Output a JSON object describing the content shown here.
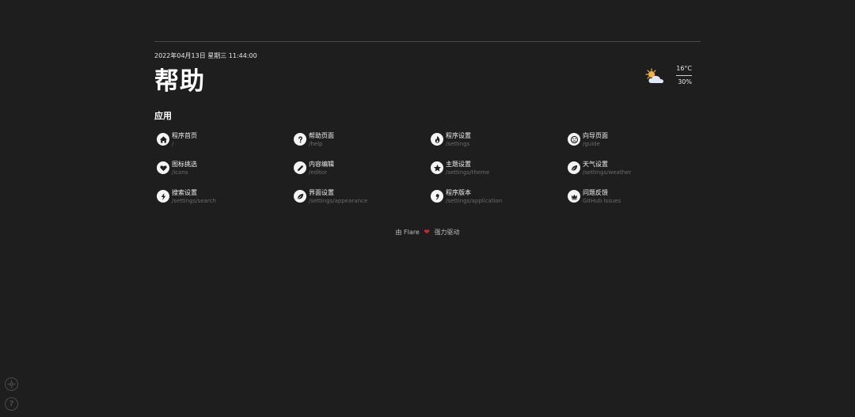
{
  "header": {
    "datetime": "2022年04月13日 星期三 11:44:00",
    "title": "帮助"
  },
  "weather": {
    "icon": "partly-cloudy-icon",
    "temperature": "16°C",
    "humidity": "30%"
  },
  "section": {
    "title": "应用"
  },
  "apps": [
    {
      "name": "程序首页",
      "path": "/",
      "icon": "home-icon"
    },
    {
      "name": "帮助页面",
      "path": "/help",
      "icon": "question-icon"
    },
    {
      "name": "程序设置",
      "path": "/settings",
      "icon": "fire-icon"
    },
    {
      "name": "向导页面",
      "path": "/guide",
      "icon": "compass-icon"
    },
    {
      "name": "图标挑选",
      "path": "/icons",
      "icon": "heart-icon"
    },
    {
      "name": "内容编辑",
      "path": "/editor",
      "icon": "pencil-icon"
    },
    {
      "name": "主题设置",
      "path": "/settings/theme",
      "icon": "star-icon"
    },
    {
      "name": "天气设置",
      "path": "/settings/weather",
      "icon": "leaf-icon"
    },
    {
      "name": "搜索设置",
      "path": "/settings/search",
      "icon": "lightning-icon"
    },
    {
      "name": "界面设置",
      "path": "/settings/appearance",
      "icon": "leaf-icon"
    },
    {
      "name": "程序版本",
      "path": "/settings/application",
      "icon": "comma-icon"
    },
    {
      "name": "问题反馈",
      "path": "GitHub Issues",
      "icon": "crown-icon"
    }
  ],
  "footer": {
    "prefix": "由 Flare",
    "suffix": "强力驱动"
  },
  "corner": {
    "settings_icon": "gear-icon",
    "help_icon": "question-icon",
    "help_glyph": "?"
  },
  "colors": {
    "background": "#1e1e1e",
    "heart": "#d9232d",
    "muted": "#6c6c6c"
  }
}
